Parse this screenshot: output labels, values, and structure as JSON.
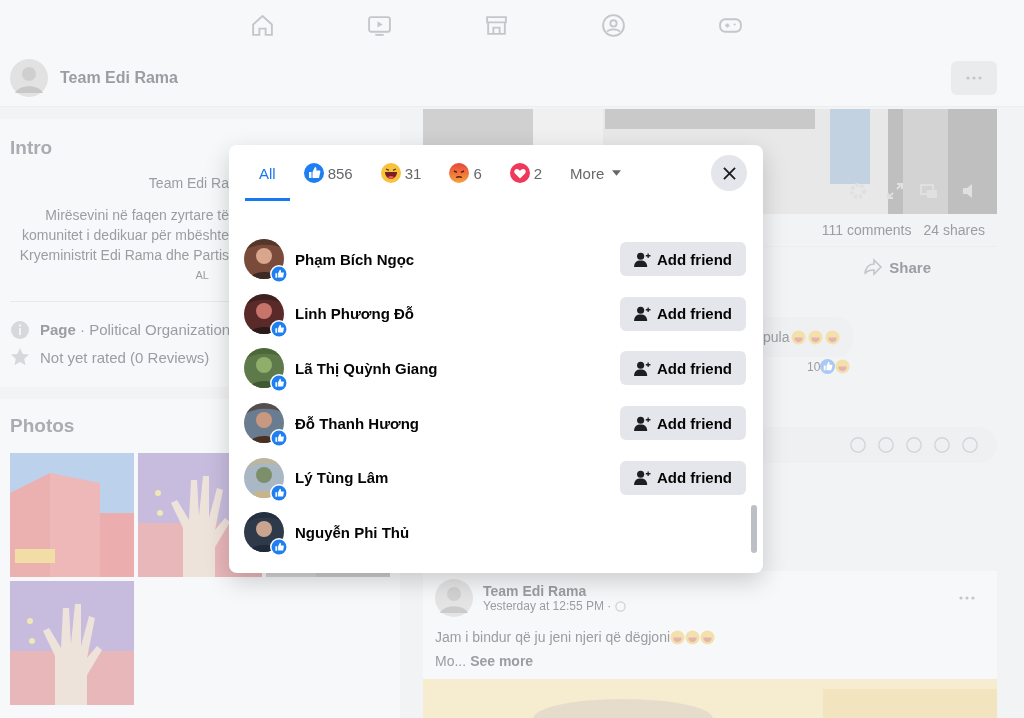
{
  "page": {
    "name": "Team Edi Rama"
  },
  "intro": {
    "title": "Intro",
    "name": "Team Edi Ra",
    "lines": [
      "Mirësevini në faqen zyrtare të",
      "komunitet i dedikuar për mbështe",
      "Kryeministrit Edi Rama dhe Partis"
    ],
    "lang": "AL",
    "category": "**Page** · Political Organization",
    "rating": "Not yet rated (0 Reviews)"
  },
  "photos": {
    "title": "Photos"
  },
  "post": {
    "comments": "111 comments",
    "shares": "24 shares",
    "share": "Share",
    "comment_text": "pula",
    "comment_reactions": "10"
  },
  "post_2": {
    "author": "Team Edi Rama",
    "time": "Yesterday at 12:55 PM ·",
    "text": "Jam i bindur që ju jeni njeri që dëgjoni",
    "more": "Mo...",
    "see_more": "See more"
  },
  "reactions_dialog": {
    "tabs": [
      {
        "kind": "all",
        "label": "All",
        "selected": true
      },
      {
        "kind": "like",
        "label": "856",
        "selected": false
      },
      {
        "kind": "haha",
        "label": "31",
        "selected": false
      },
      {
        "kind": "angry",
        "label": "6",
        "selected": false
      },
      {
        "kind": "love",
        "label": "2",
        "selected": false
      },
      {
        "kind": "more",
        "label": "More",
        "selected": false
      }
    ],
    "people": [
      {
        "name": "Phạm Bích Ngọc",
        "liked": true,
        "action": "Add friend"
      },
      {
        "name": "Linh Phương Đỗ",
        "liked": true,
        "action": "Add friend"
      },
      {
        "name": "Lã Thị Quỳnh Giang",
        "liked": true,
        "action": "Add friend"
      },
      {
        "name": "Đỗ Thanh Hương",
        "liked": true,
        "action": "Add friend"
      },
      {
        "name": "Lý Tùng Lâm",
        "liked": true,
        "action": "Add friend"
      },
      {
        "name": "Nguyễn Phi Thủ",
        "liked": true
      }
    ]
  }
}
